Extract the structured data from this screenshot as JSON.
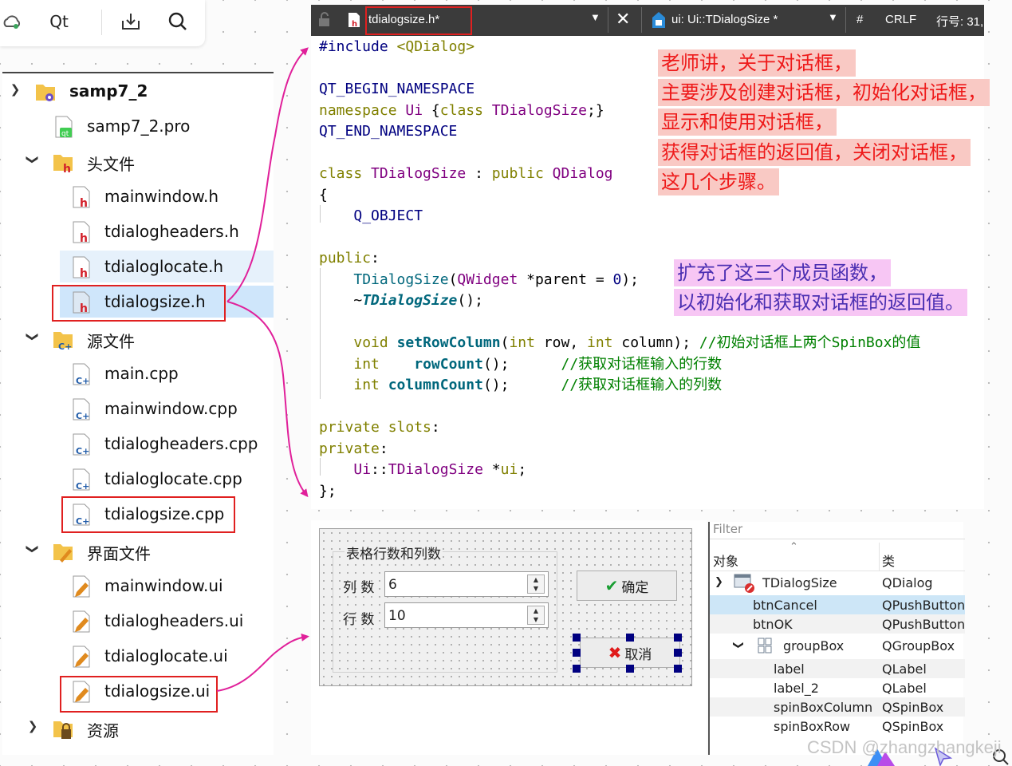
{
  "toolbar": {
    "qt_label": "Qt",
    "icons": [
      "cloud-icon",
      "download-icon",
      "search-icon"
    ]
  },
  "tree": {
    "project": "samp7_2",
    "pro_file": "samp7_2.pro",
    "headers_group": "头文件",
    "headers": [
      "mainwindow.h",
      "tdialogheaders.h",
      "tdialoglocate.h",
      "tdialogsize.h"
    ],
    "sources_group": "源文件",
    "sources": [
      "main.cpp",
      "mainwindow.cpp",
      "tdialogheaders.cpp",
      "tdialoglocate.cpp",
      "tdialogsize.cpp"
    ],
    "forms_group": "界面文件",
    "forms": [
      "mainwindow.ui",
      "tdialogheaders.ui",
      "tdialoglocate.ui",
      "tdialogsize.ui"
    ],
    "resources_group": "资源"
  },
  "editor": {
    "tab_file": "tdialogsize.h*",
    "tab_symbol": "ui: Ui::TDialogSize *",
    "tab_hash": "#",
    "tab_eol": "CRLF",
    "tab_line": "行号: 31,",
    "comment_1": "//初始对话框上两个SpinBox的值",
    "comment_2": "//获取对话框输入的行数",
    "comment_3": "//获取对话框输入的列数"
  },
  "notes": {
    "red": [
      "老师讲，关于对话框，",
      "主要涉及创建对话框，初始化对话框，",
      "显示和使用对话框，",
      "获得对话框的返回值，关闭对话框，",
      "这几个步骤。"
    ],
    "pink": [
      "扩充了这三个成员函数，",
      "以初始化和获取对话框的返回值。"
    ]
  },
  "dialog": {
    "group_title": "表格行数和列数",
    "col_label": "列 数",
    "col_value": "6",
    "row_label": "行 数",
    "row_value": "10",
    "ok_label": "确定",
    "cancel_label": "取消"
  },
  "inspector": {
    "filter": "Filter",
    "col_object": "对象",
    "col_class": "类",
    "rows": [
      {
        "object": "TDialogSize",
        "class": "QDialog"
      },
      {
        "object": "btnCancel",
        "class": "QPushButton"
      },
      {
        "object": "btnOK",
        "class": "QPushButton"
      },
      {
        "object": "groupBox",
        "class": "QGroupBox"
      },
      {
        "object": "label",
        "class": "QLabel"
      },
      {
        "object": "label_2",
        "class": "QLabel"
      },
      {
        "object": "spinBoxColumn",
        "class": "QSpinBox"
      },
      {
        "object": "spinBoxRow",
        "class": "QSpinBox"
      }
    ]
  },
  "watermark": "CSDN @zhangzhangkeji",
  "colors": {
    "annotation_red": "#e02020",
    "arrow_magenta": "#e0209a",
    "note_red_bg": "#f9c9c4",
    "note_pink_bg": "#f7c6f4"
  }
}
